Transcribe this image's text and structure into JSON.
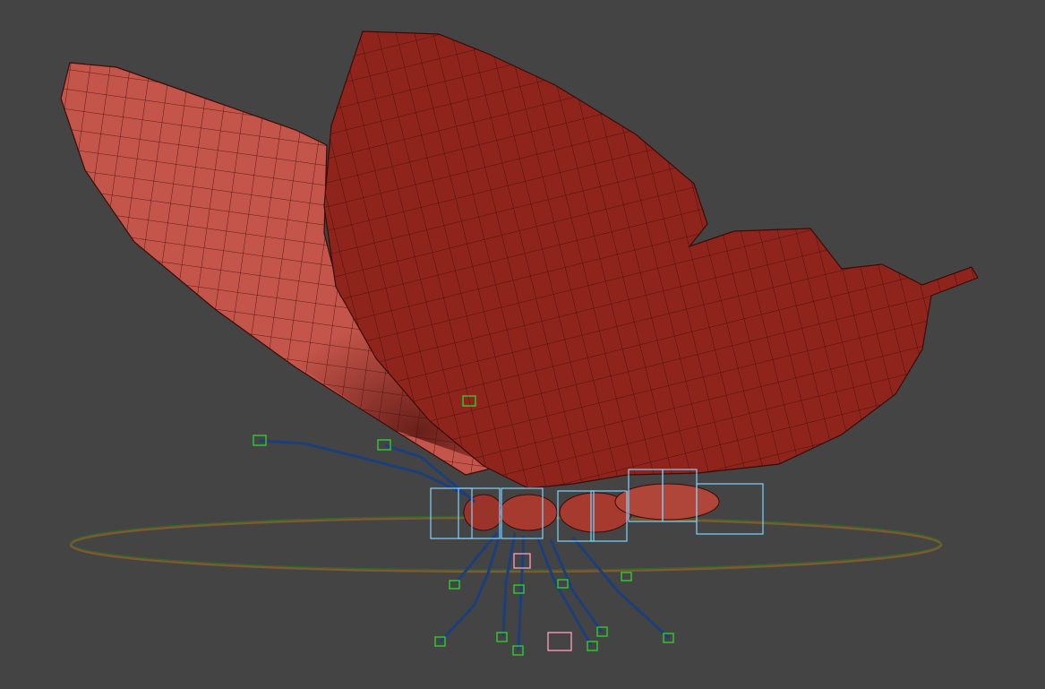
{
  "viewport": {
    "background": "#444444",
    "mesh_color": "#b8473c",
    "mesh_dark": "#6f1712",
    "wire_color": "#3a0c08",
    "control_circle_color": "#8b5e3c",
    "bone_box_color": "#7fd3ff",
    "control_handle_color": "#2fd52f",
    "helper_color": "#ff9fc4",
    "rig_line_color": "#1c3f7a"
  },
  "scene": {
    "object": "butterfly-model",
    "icons": [
      "control-handle-icon",
      "bone-box-icon",
      "helper-icon",
      "ground-circle"
    ]
  }
}
